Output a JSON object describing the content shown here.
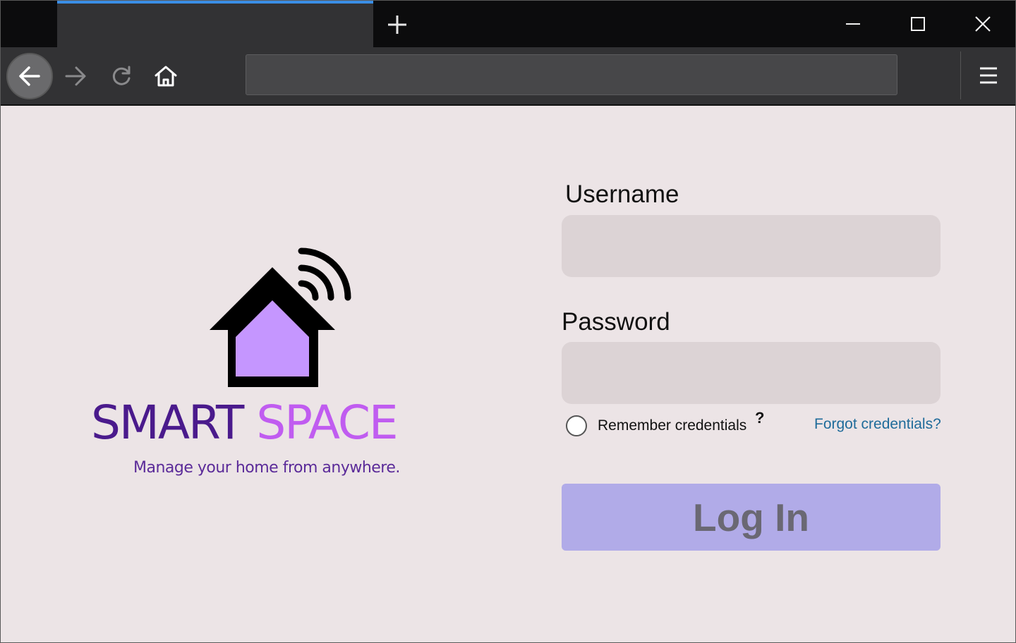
{
  "browser": {
    "tab_title": "",
    "url": "",
    "icons": {
      "new_tab": "plus-icon",
      "minimize": "minimize-icon",
      "maximize": "maximize-icon",
      "close": "close-icon",
      "back": "arrow-left-icon",
      "forward": "arrow-right-icon",
      "reload": "reload-icon",
      "home": "home-icon",
      "menu": "hamburger-menu-icon"
    },
    "colors": {
      "tab_indicator": "#3a8ee6",
      "chrome_dark": "#0c0c0d",
      "toolbar": "#323234"
    }
  },
  "logo": {
    "word1": "SMART",
    "word2": "SPACE",
    "tagline": "Manage your home from anywhere.",
    "colors": {
      "word1": "#4a1a8c",
      "word2": "#c05cf0",
      "house_fill": "#c596ff"
    }
  },
  "form": {
    "username_label": "Username",
    "username_value": "",
    "password_label": "Password",
    "password_value": "",
    "remember_label": "Remember credentials",
    "remember_checked": false,
    "help_mark": "?",
    "forgot_link": "Forgot credentials?",
    "login_button": "Log In",
    "colors": {
      "button_bg": "#b1abe8",
      "link": "#1f6b9a"
    }
  }
}
